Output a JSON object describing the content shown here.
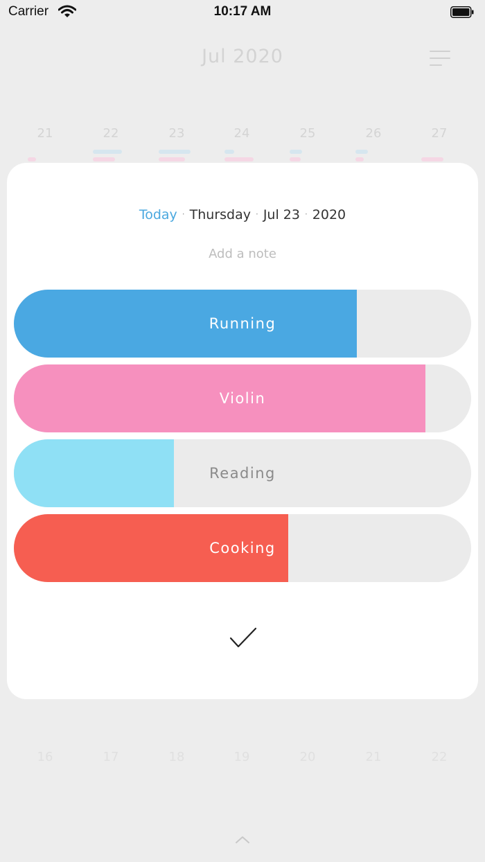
{
  "status_bar": {
    "carrier": "Carrier",
    "time": "10:17 AM"
  },
  "calendar": {
    "month_title": "Jul 2020",
    "week_days": [
      "21",
      "22",
      "23",
      "24",
      "25",
      "26",
      "27"
    ],
    "next_week_days": [
      "16",
      "17",
      "18",
      "19",
      "20",
      "21",
      "22"
    ]
  },
  "day_card": {
    "today_label": "Today",
    "separator": "·",
    "weekday": "Thursday",
    "date": "Jul 23",
    "year": "2020",
    "note_placeholder": "Add a note"
  },
  "habits": [
    {
      "label": "Running",
      "progress": 0.75,
      "color": "#4aa8e2",
      "label_color": "#ffffff"
    },
    {
      "label": "Violin",
      "progress": 0.9,
      "color": "#f690be",
      "label_color": "#ffffff"
    },
    {
      "label": "Reading",
      "progress": 0.35,
      "color": "#8fe0f5",
      "label_color": "#8a8a8a"
    },
    {
      "label": "Cooking",
      "progress": 0.6,
      "color": "#f65e51",
      "label_color": "#ffffff"
    }
  ],
  "icons": {
    "menu": "menu-icon",
    "confirm": "checkmark-icon",
    "expand": "chevron-up-icon"
  }
}
